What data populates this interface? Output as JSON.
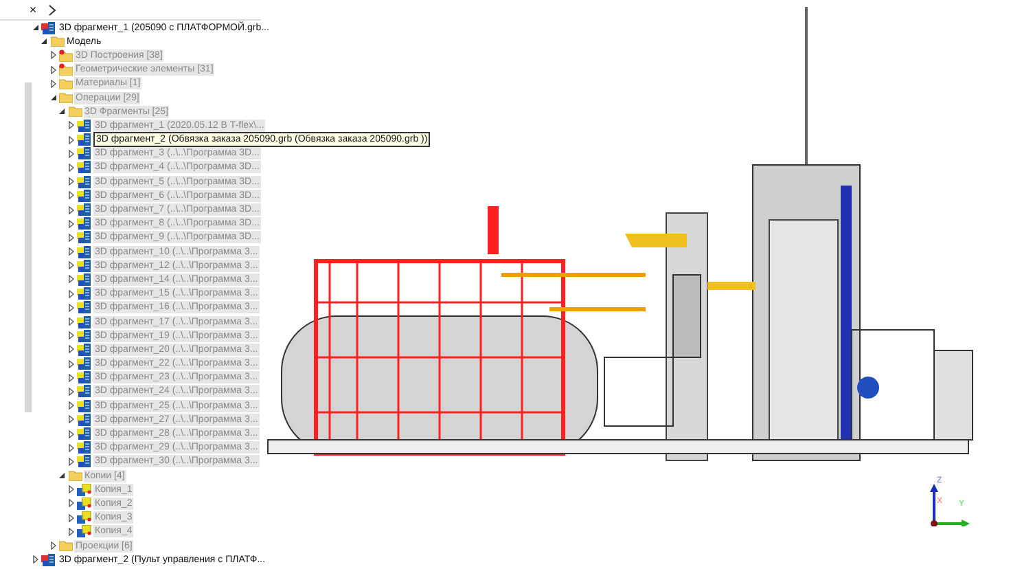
{
  "toolbar": {
    "buttons": [
      {
        "kind": "close",
        "label": "×"
      },
      {
        "kind": "pin"
      }
    ]
  },
  "tree": [
    {
      "label": "3D фрагмент_1 (205090 с ПЛАТФОРМОЙ.grb...",
      "kind": "fragment_root",
      "expanded": true,
      "dimmed": false,
      "children": [
        {
          "label": "Модель",
          "kind": "folder",
          "expanded": true,
          "dimmed": false,
          "children": [
            {
              "label": "3D Построения [38]",
              "kind": "folder_marked",
              "expanded": false,
              "dimmed": true
            },
            {
              "label": "Геометрические элементы [31]",
              "kind": "folder_marked",
              "expanded": false,
              "dimmed": true
            },
            {
              "label": "Материалы [1]",
              "kind": "folder",
              "expanded": false,
              "dimmed": true
            },
            {
              "label": "Операции [29]",
              "kind": "folder",
              "expanded": true,
              "dimmed": true,
              "children": [
                {
                  "label": "3D Фрагменты [25]",
                  "kind": "folder",
                  "expanded": true,
                  "dimmed": true,
                  "children": [
                    {
                      "label": "3D фрагмент_1 (2020.05.12 В T-flex\\...",
                      "kind": "fragment",
                      "expanded": false,
                      "dimmed": true
                    },
                    {
                      "label": "3D фрагмент_2 (Обвязка заказа 205090.grb (Обвязка заказа 205090.grb ))",
                      "kind": "fragment",
                      "expanded": false,
                      "dimmed": false,
                      "tooltip": true
                    },
                    {
                      "label": "3D фрагмент_3 (..\\..\\Программа 3D...",
                      "kind": "fragment",
                      "expanded": false,
                      "dimmed": true
                    },
                    {
                      "label": "3D фрагмент_4 (..\\..\\Программа 3D...",
                      "kind": "fragment",
                      "expanded": false,
                      "dimmed": true
                    },
                    {
                      "label": "3D фрагмент_5 (..\\..\\Программа 3D...",
                      "kind": "fragment",
                      "expanded": false,
                      "dimmed": true
                    },
                    {
                      "label": "3D фрагмент_6 (..\\..\\Программа 3D...",
                      "kind": "fragment",
                      "expanded": false,
                      "dimmed": true
                    },
                    {
                      "label": "3D фрагмент_7 (..\\..\\Программа 3D...",
                      "kind": "fragment",
                      "expanded": false,
                      "dimmed": true
                    },
                    {
                      "label": "3D фрагмент_8 (..\\..\\Программа 3D...",
                      "kind": "fragment",
                      "expanded": false,
                      "dimmed": true
                    },
                    {
                      "label": "3D фрагмент_9 (..\\..\\Программа 3D...",
                      "kind": "fragment",
                      "expanded": false,
                      "dimmed": true
                    },
                    {
                      "label": "3D фрагмент_10 (..\\..\\Программа 3...",
                      "kind": "fragment",
                      "expanded": false,
                      "dimmed": true
                    },
                    {
                      "label": "3D фрагмент_12 (..\\..\\Программа 3...",
                      "kind": "fragment",
                      "expanded": false,
                      "dimmed": true
                    },
                    {
                      "label": "3D фрагмент_14 (..\\..\\Программа 3...",
                      "kind": "fragment",
                      "expanded": false,
                      "dimmed": true
                    },
                    {
                      "label": "3D фрагмент_15 (..\\..\\Программа 3...",
                      "kind": "fragment",
                      "expanded": false,
                      "dimmed": true
                    },
                    {
                      "label": "3D фрагмент_16 (..\\..\\Программа 3...",
                      "kind": "fragment",
                      "expanded": false,
                      "dimmed": true
                    },
                    {
                      "label": "3D фрагмент_17 (..\\..\\Программа 3...",
                      "kind": "fragment",
                      "expanded": false,
                      "dimmed": true
                    },
                    {
                      "label": "3D фрагмент_19 (..\\..\\Программа 3...",
                      "kind": "fragment",
                      "expanded": false,
                      "dimmed": true
                    },
                    {
                      "label": "3D фрагмент_20 (..\\..\\Программа 3...",
                      "kind": "fragment",
                      "expanded": false,
                      "dimmed": true
                    },
                    {
                      "label": "3D фрагмент_22 (..\\..\\Программа 3...",
                      "kind": "fragment",
                      "expanded": false,
                      "dimmed": true
                    },
                    {
                      "label": "3D фрагмент_23 (..\\..\\Программа 3...",
                      "kind": "fragment",
                      "expanded": false,
                      "dimmed": true
                    },
                    {
                      "label": "3D фрагмент_24 (..\\..\\Программа 3...",
                      "kind": "fragment",
                      "expanded": false,
                      "dimmed": true
                    },
                    {
                      "label": "3D фрагмент_25 (..\\..\\Программа 3...",
                      "kind": "fragment",
                      "expanded": false,
                      "dimmed": true
                    },
                    {
                      "label": "3D фрагмент_27 (..\\..\\Программа 3...",
                      "kind": "fragment",
                      "expanded": false,
                      "dimmed": true
                    },
                    {
                      "label": "3D фрагмент_28 (..\\..\\Программа 3...",
                      "kind": "fragment",
                      "expanded": false,
                      "dimmed": true
                    },
                    {
                      "label": "3D фрагмент_29 (..\\..\\Программа 3...",
                      "kind": "fragment",
                      "expanded": false,
                      "dimmed": true
                    },
                    {
                      "label": "3D фрагмент_30 (..\\..\\Программа 3...",
                      "kind": "fragment",
                      "expanded": false,
                      "dimmed": true
                    }
                  ]
                },
                {
                  "label": "Копии [4]",
                  "kind": "folder",
                  "expanded": true,
                  "dimmed": true,
                  "children": [
                    {
                      "label": "Копия_1",
                      "kind": "copy",
                      "expanded": false,
                      "dimmed": true
                    },
                    {
                      "label": "Копия_2",
                      "kind": "copy",
                      "expanded": false,
                      "dimmed": true
                    },
                    {
                      "label": "Копия_3",
                      "kind": "copy",
                      "expanded": false,
                      "dimmed": true
                    },
                    {
                      "label": "Копия_4",
                      "kind": "copy",
                      "expanded": false,
                      "dimmed": true
                    }
                  ]
                }
              ]
            },
            {
              "label": "Проекции [6]",
              "kind": "folder",
              "expanded": false,
              "dimmed": true
            }
          ]
        }
      ]
    },
    {
      "label": "3D фрагмент_2 (Пульт управления с ПЛАТФ...",
      "kind": "fragment_root",
      "expanded": false,
      "dimmed": false
    }
  ],
  "axes": [
    {
      "label": "Z"
    },
    {
      "label": "X"
    },
    {
      "label": "Y"
    }
  ]
}
